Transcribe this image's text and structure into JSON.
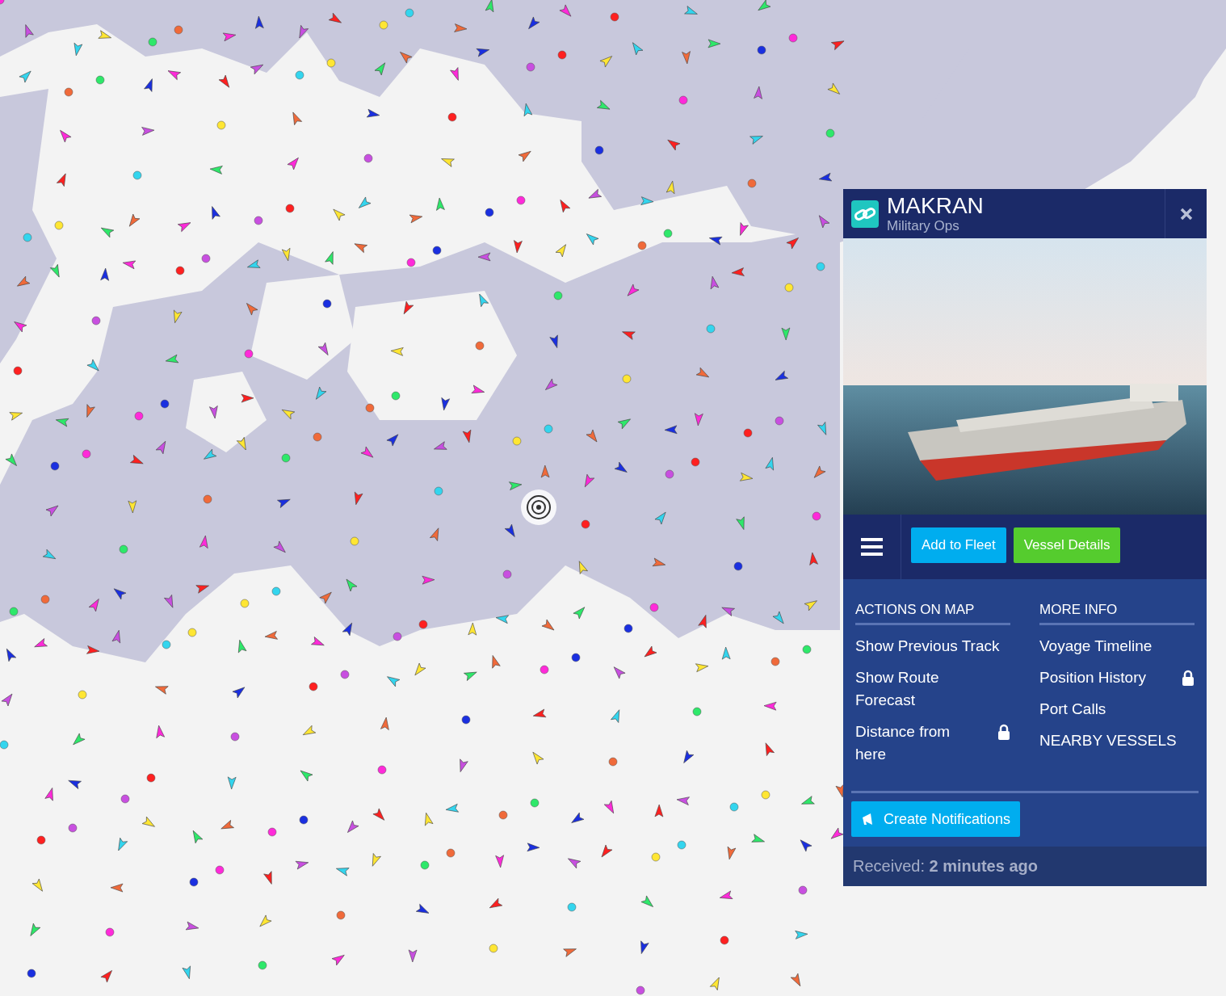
{
  "vessel_popup": {
    "name": "MAKRAN",
    "type": "Military Ops",
    "toolbar": {
      "buttons": [
        {
          "label": "Add to Fleet",
          "kind": "fleet"
        },
        {
          "label": "Vessel Details",
          "kind": "details"
        }
      ]
    },
    "sections": [
      {
        "heading": "ACTIONS ON MAP",
        "items": [
          {
            "label": "Show Previous Track",
            "locked": false
          },
          {
            "label": "Show Route Forecast",
            "locked": false
          },
          {
            "label": "Distance from here",
            "locked": true
          }
        ]
      },
      {
        "heading": "MORE INFO",
        "items": [
          {
            "label": "Voyage Timeline",
            "locked": false
          },
          {
            "label": "Position History",
            "locked": true
          },
          {
            "label": "Port Calls",
            "locked": false
          },
          {
            "label": "NEARBY VESSELS",
            "locked": false
          }
        ]
      }
    ],
    "notify_button": "Create Notifications",
    "received": "Received: **2 minutes ago**"
  }
}
